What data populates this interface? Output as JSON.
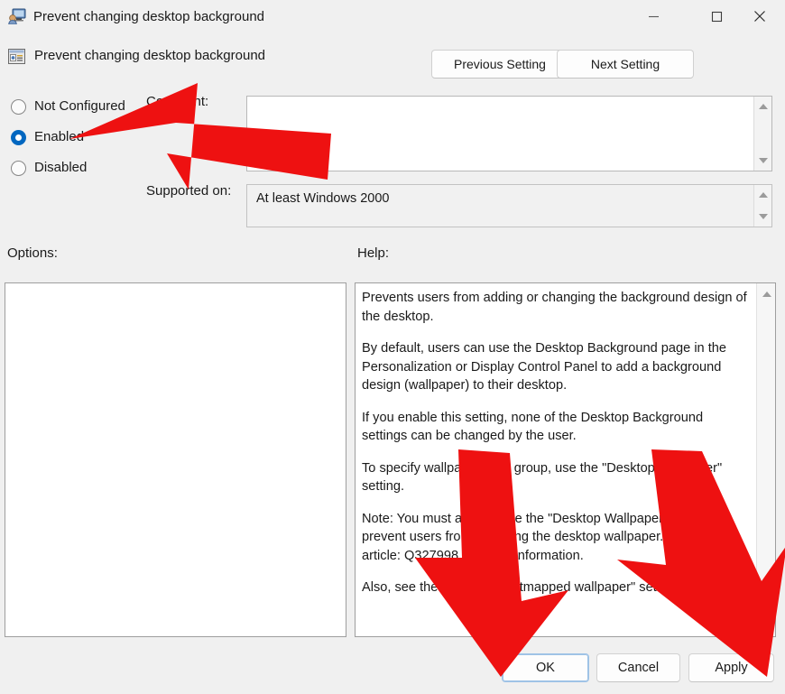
{
  "window": {
    "title": "Prevent changing desktop background",
    "icon": "policy-window-icon",
    "controls": {
      "minimize": "Minimize",
      "maximize": "Maximize",
      "close": "Close"
    }
  },
  "header": {
    "setting_icon": "group-policy-setting-icon",
    "setting_name": "Prevent changing desktop background",
    "previous_label": "Previous Setting",
    "next_label": "Next Setting"
  },
  "state_options": {
    "items": [
      {
        "label": "Not Configured",
        "selected": false
      },
      {
        "label": "Enabled",
        "selected": true
      },
      {
        "label": "Disabled",
        "selected": false
      }
    ]
  },
  "comment": {
    "label": "Comment:",
    "value": "",
    "placeholder": ""
  },
  "supported_on": {
    "label": "Supported on:",
    "value": "At least Windows 2000"
  },
  "sections": {
    "options_label": "Options:",
    "help_label": "Help:"
  },
  "options_panel": {
    "content": ""
  },
  "help_panel": {
    "paragraphs": [
      "Prevents users from adding or changing the background design of the desktop.",
      "By default, users can use the Desktop Background page in the Personalization or Display Control Panel to add a background design (wallpaper) to their desktop.",
      "If you enable this setting, none of the Desktop Background settings can be changed by the user.",
      "To specify wallpaper for a group, use the \"Desktop Wallpaper\" setting.",
      "Note: You must also enable the \"Desktop Wallpaper\" setting to prevent users from changing the desktop wallpaper. See KB article: Q327998 for more information.",
      "Also, see the \"Allow only bitmapped wallpaper\" setting."
    ]
  },
  "footer": {
    "ok_label": "OK",
    "cancel_label": "Cancel",
    "apply_label": "Apply"
  },
  "annotations": {
    "color": "#ee1111",
    "items": [
      {
        "name": "arrow-pointing-to-enabled-radio",
        "direction": "left"
      },
      {
        "name": "arrow-pointing-to-ok-button",
        "direction": "down"
      },
      {
        "name": "arrow-pointing-to-apply-button",
        "direction": "down"
      }
    ]
  },
  "colors": {
    "window_background": "#f0f0f0",
    "accent": "#0067c0",
    "annotation_red": "#ee1111",
    "field_background": "#ffffff"
  }
}
